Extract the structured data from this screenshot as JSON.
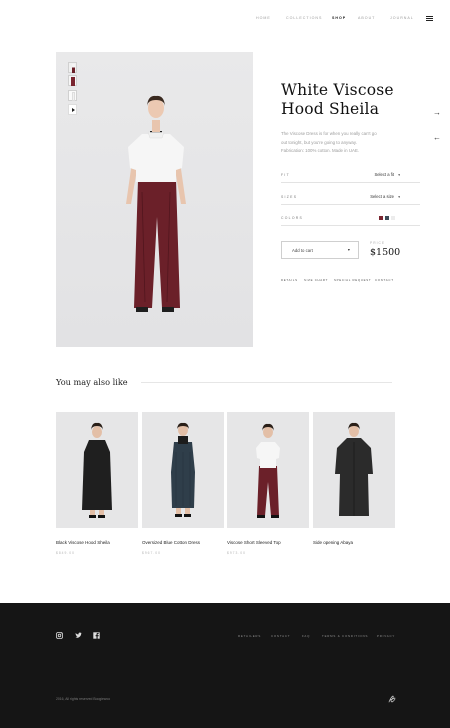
{
  "nav": {
    "items": [
      "Home",
      "Collections",
      "Shop",
      "About",
      "Journal"
    ],
    "active": "Shop",
    "menu_icon": "hamburger-icon"
  },
  "product": {
    "title_line1": "White Viscose",
    "title_line2": "Hood Sheila",
    "description": "The Viscose Dress is for when you really can't go out tonight, but you're going to anyway. Fabrication: 100% cotton. Made in UAE.",
    "fit_label": "Fit",
    "fit_value": "Select a fit",
    "sizes_label": "Sizes",
    "sizes_value": "Select a size",
    "colors_label": "Colors",
    "color_swatches": [
      "#7a2530",
      "#3a4a56",
      "#ececec"
    ],
    "add_to_cart": "Add to cart",
    "price_label": "Price",
    "price": "$1500",
    "links": [
      "Details",
      "Size chart",
      "Special request",
      "Contact"
    ],
    "next_icon": "arrow-right-icon",
    "prev_icon": "arrow-left-icon"
  },
  "related": {
    "heading": "You may also like",
    "items": [
      {
        "title": "Black Viscose Hood Sheila",
        "price": "$849.00"
      },
      {
        "title": "Oversized Blue Cotton Dress",
        "price": "$967.00"
      },
      {
        "title": "Viscose Short Sleeved Top",
        "price": "$973.00"
      },
      {
        "title": "Side opening Abaya",
        "price": ""
      }
    ]
  },
  "footer": {
    "social": [
      "instagram-icon",
      "twitter-icon",
      "facebook-icon"
    ],
    "links": [
      "Retailers",
      "Contact",
      "FAQ",
      "Terms & Conditions",
      "Privacy"
    ],
    "copyright": "2016, All rights reserved Boogiewoo",
    "logo_icon": "signature-logo-icon"
  },
  "colors": {
    "footer_bg": "#151515",
    "maroon": "#7a2530",
    "accent_text": "#111111"
  }
}
